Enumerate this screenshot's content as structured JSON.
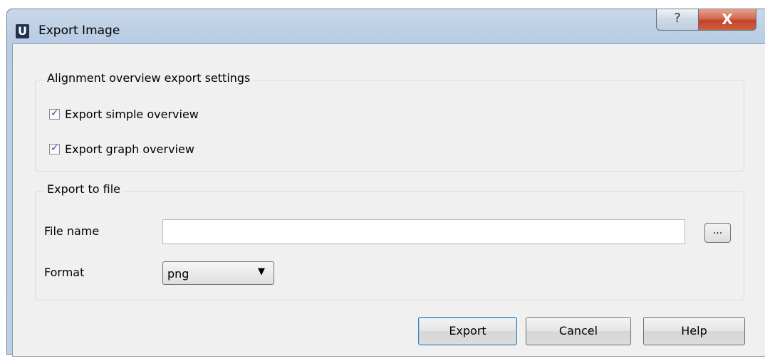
{
  "window": {
    "title": "Export Image",
    "app_icon_letter": "U",
    "help_glyph": "?",
    "close_glyph": "X"
  },
  "alignment_group": {
    "legend": "Alignment overview export settings",
    "options": [
      {
        "label": "Export simple overview",
        "checked": true
      },
      {
        "label": "Export graph overview",
        "checked": true
      }
    ]
  },
  "export_group": {
    "legend": "Export to file",
    "file_name_label": "File name",
    "file_name_value": "",
    "browse_label": "...",
    "format_label": "Format",
    "format_value": "png"
  },
  "buttons": {
    "export": "Export",
    "cancel": "Cancel",
    "help": "Help"
  },
  "icons": {
    "app": "app-logo-icon",
    "help": "question-icon",
    "close": "close-icon",
    "checkmark": "checkmark-icon",
    "dropdown": "chevron-down-icon"
  },
  "colors": {
    "close_button": "#c2432a",
    "titlebar": "#bcd0e6",
    "client_bg": "#f0f0f0",
    "default_button_border": "#3c7fb1"
  }
}
